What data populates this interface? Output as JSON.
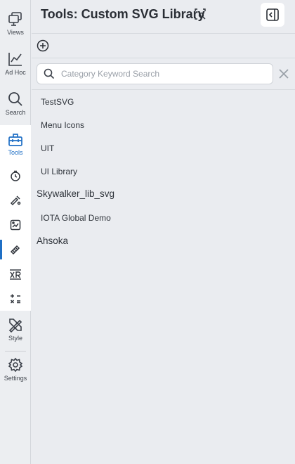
{
  "nav": {
    "views_label": "Views",
    "adhoc_label": "Ad Hoc",
    "search_label": "Search",
    "tools_label": "Tools",
    "style_label": "Style",
    "settings_label": "Settings",
    "tool_items": [
      "timer-icon",
      "paint-icon",
      "image-edit-icon",
      "svg-library-icon",
      "xr-icon",
      "calculator-icon"
    ],
    "active_tool": "svg-library-icon",
    "accent": "#1f6fc5"
  },
  "header": {
    "title": "Tools: Custom SVG Library"
  },
  "search": {
    "placeholder": "Category Keyword Search",
    "value": ""
  },
  "categories": [
    {
      "label": "TestSVG",
      "level": "child"
    },
    {
      "label": "Menu Icons",
      "level": "child"
    },
    {
      "label": "UIT",
      "level": "child"
    },
    {
      "label": "UI Library",
      "level": "child"
    },
    {
      "label": "Skywalker_lib_svg",
      "level": "root"
    },
    {
      "label": "IOTA Global Demo",
      "level": "child"
    },
    {
      "label": "Ahsoka",
      "level": "root"
    }
  ]
}
